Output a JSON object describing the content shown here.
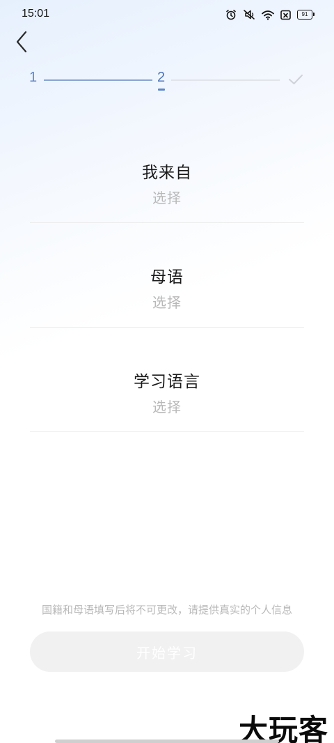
{
  "status_bar": {
    "time": "15:01",
    "battery_level": "91",
    "icons": [
      "alarm-icon",
      "mute-icon",
      "wifi-icon",
      "no-sim-icon",
      "battery-icon"
    ]
  },
  "nav": {
    "back_icon": "chevron-left-icon"
  },
  "stepper": {
    "step1_label": "1",
    "step2_label": "2",
    "final_icon": "check-icon",
    "current_step": 2,
    "colors": {
      "active": "#5d86c8",
      "inactive": "#e1e4e8"
    }
  },
  "fields": [
    {
      "title": "我来自",
      "value": "选择"
    },
    {
      "title": "母语",
      "value": "选择"
    },
    {
      "title": "学习语言",
      "value": "选择"
    }
  ],
  "notice": "国籍和母语填写后将不可更改，请提供真实的个人信息",
  "start_button": {
    "label": "开始学习",
    "enabled": false
  },
  "watermark": "大玩客"
}
